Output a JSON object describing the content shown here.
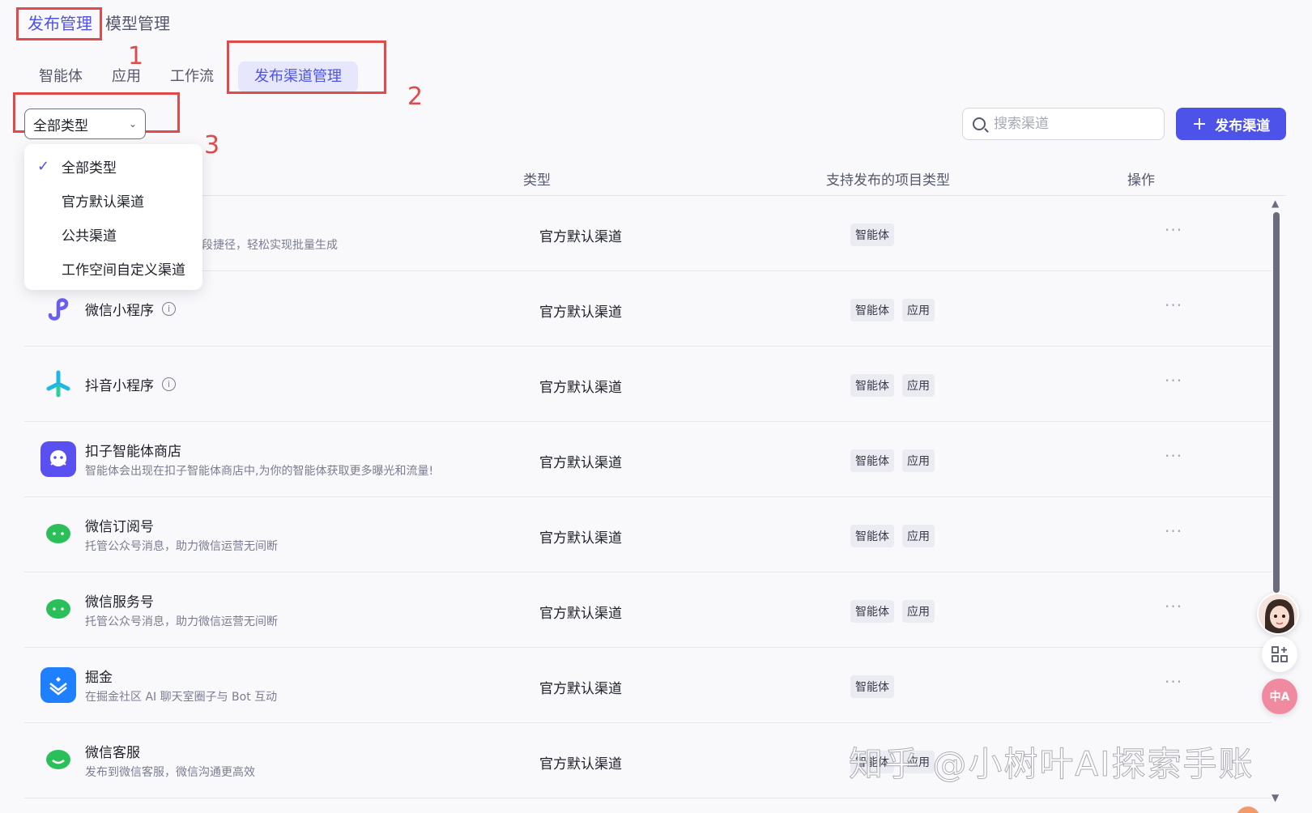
{
  "top_tabs": {
    "publish_mgmt": "发布管理",
    "model_mgmt": "模型管理"
  },
  "sub_tabs": [
    "智能体",
    "应用",
    "工作流",
    "发布渠道管理"
  ],
  "annotations": [
    "1",
    "2",
    "3"
  ],
  "type_select": {
    "value": "全部类型"
  },
  "dropdown": {
    "items": [
      "全部类型",
      "官方默认渠道",
      "公共渠道",
      "工作空间自定义渠道"
    ],
    "selected_index": 0
  },
  "search": {
    "placeholder": "搜索渠道"
  },
  "publish_button": {
    "label": "发布渠道"
  },
  "table": {
    "headers": {
      "type": "类型",
      "project_types": "支持发布的项目类型",
      "actions": "操作"
    },
    "rows": [
      {
        "name": "",
        "desc": "字段捷径，轻松实现批量生成",
        "type": "官方默认渠道",
        "tags": [
          "智能体"
        ],
        "icon": "hidden-icon"
      },
      {
        "name": "微信小程序",
        "desc": "",
        "type": "官方默认渠道",
        "tags": [
          "智能体",
          "应用"
        ],
        "icon": "wechat-miniprogram-icon",
        "info": true
      },
      {
        "name": "抖音小程序",
        "desc": "",
        "type": "官方默认渠道",
        "tags": [
          "智能体",
          "应用"
        ],
        "icon": "douyin-miniprogram-icon",
        "info": true
      },
      {
        "name": "扣子智能体商店",
        "desc": "智能体会出现在扣子智能体商店中,为你的智能体获取更多曝光和流量!",
        "type": "官方默认渠道",
        "tags": [
          "智能体",
          "应用"
        ],
        "icon": "coze-store-icon"
      },
      {
        "name": "微信订阅号",
        "desc": "托管公众号消息，助力微信运营无间断",
        "type": "官方默认渠道",
        "tags": [
          "智能体",
          "应用"
        ],
        "icon": "wechat-icon"
      },
      {
        "name": "微信服务号",
        "desc": "托管公众号消息，助力微信运营无间断",
        "type": "官方默认渠道",
        "tags": [
          "智能体",
          "应用"
        ],
        "icon": "wechat-icon"
      },
      {
        "name": "掘金",
        "desc": "在掘金社区 AI 聊天室圈子与 Bot 互动",
        "type": "官方默认渠道",
        "tags": [
          "智能体"
        ],
        "icon": "juejin-icon"
      },
      {
        "name": "微信客服",
        "desc": "发布到微信客服，微信沟通更高效",
        "type": "官方默认渠道",
        "tags": [
          "智能体",
          "应用"
        ],
        "icon": "wechat-service-icon"
      }
    ],
    "ops_glyph": "···"
  },
  "info_glyph": "i",
  "check_glyph": "✓",
  "watermark": "知乎 @小树叶AI探索手账",
  "colors": {
    "accent": "#4d53e8",
    "annotation": "#e04a4a",
    "wechat": "#2bbf5a",
    "douyin": "#1fb8e6"
  }
}
